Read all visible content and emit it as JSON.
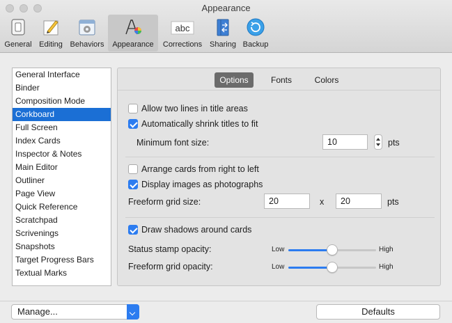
{
  "window": {
    "title": "Appearance"
  },
  "toolbar": {
    "items": [
      {
        "label": "General",
        "icon": "switch-icon"
      },
      {
        "label": "Editing",
        "icon": "pencil-icon"
      },
      {
        "label": "Behaviors",
        "icon": "gear-icon"
      },
      {
        "label": "Appearance",
        "icon": "font-color-icon",
        "selected": true
      },
      {
        "label": "Corrections",
        "icon": "abc-icon"
      },
      {
        "label": "Sharing",
        "icon": "sharing-icon"
      },
      {
        "label": "Backup",
        "icon": "backup-icon"
      }
    ],
    "abc_text": "abc"
  },
  "sidebar": {
    "items": [
      "General Interface",
      "Binder",
      "Composition Mode",
      "Corkboard",
      "Full Screen",
      "Index Cards",
      "Inspector & Notes",
      "Main Editor",
      "Outliner",
      "Page View",
      "Quick Reference",
      "Scratchpad",
      "Scrivenings",
      "Snapshots",
      "Target Progress Bars",
      "Textual Marks"
    ],
    "selected": "Corkboard"
  },
  "tabs": {
    "options": "Options",
    "fonts": "Fonts",
    "colors": "Colors",
    "active": "Options"
  },
  "options": {
    "allow_two_lines": {
      "label": "Allow two lines in title areas",
      "checked": false
    },
    "auto_shrink": {
      "label": "Automatically shrink titles to fit",
      "checked": true
    },
    "min_font_size": {
      "label": "Minimum font size:",
      "value": "10",
      "unit": "pts"
    },
    "arrange_right_left": {
      "label": "Arrange cards from right to left",
      "checked": false
    },
    "display_photos": {
      "label": "Display images as photographs",
      "checked": true
    },
    "grid_size": {
      "label": "Freeform grid size:",
      "x_value": "20",
      "separator": "x",
      "y_value": "20",
      "unit": "pts"
    },
    "draw_shadows": {
      "label": "Draw shadows around cards",
      "checked": true
    },
    "stamp_opacity": {
      "label": "Status stamp opacity:",
      "low": "Low",
      "high": "High",
      "value": 0.5
    },
    "grid_opacity": {
      "label": "Freeform grid opacity:",
      "low": "Low",
      "high": "High",
      "value": 0.5
    }
  },
  "footer": {
    "manage_label": "Manage...",
    "defaults_label": "Defaults"
  },
  "colors": {
    "accent": "#2c7cf0",
    "selection": "#1b6fd5",
    "tab_active": "#6b6b6b"
  }
}
